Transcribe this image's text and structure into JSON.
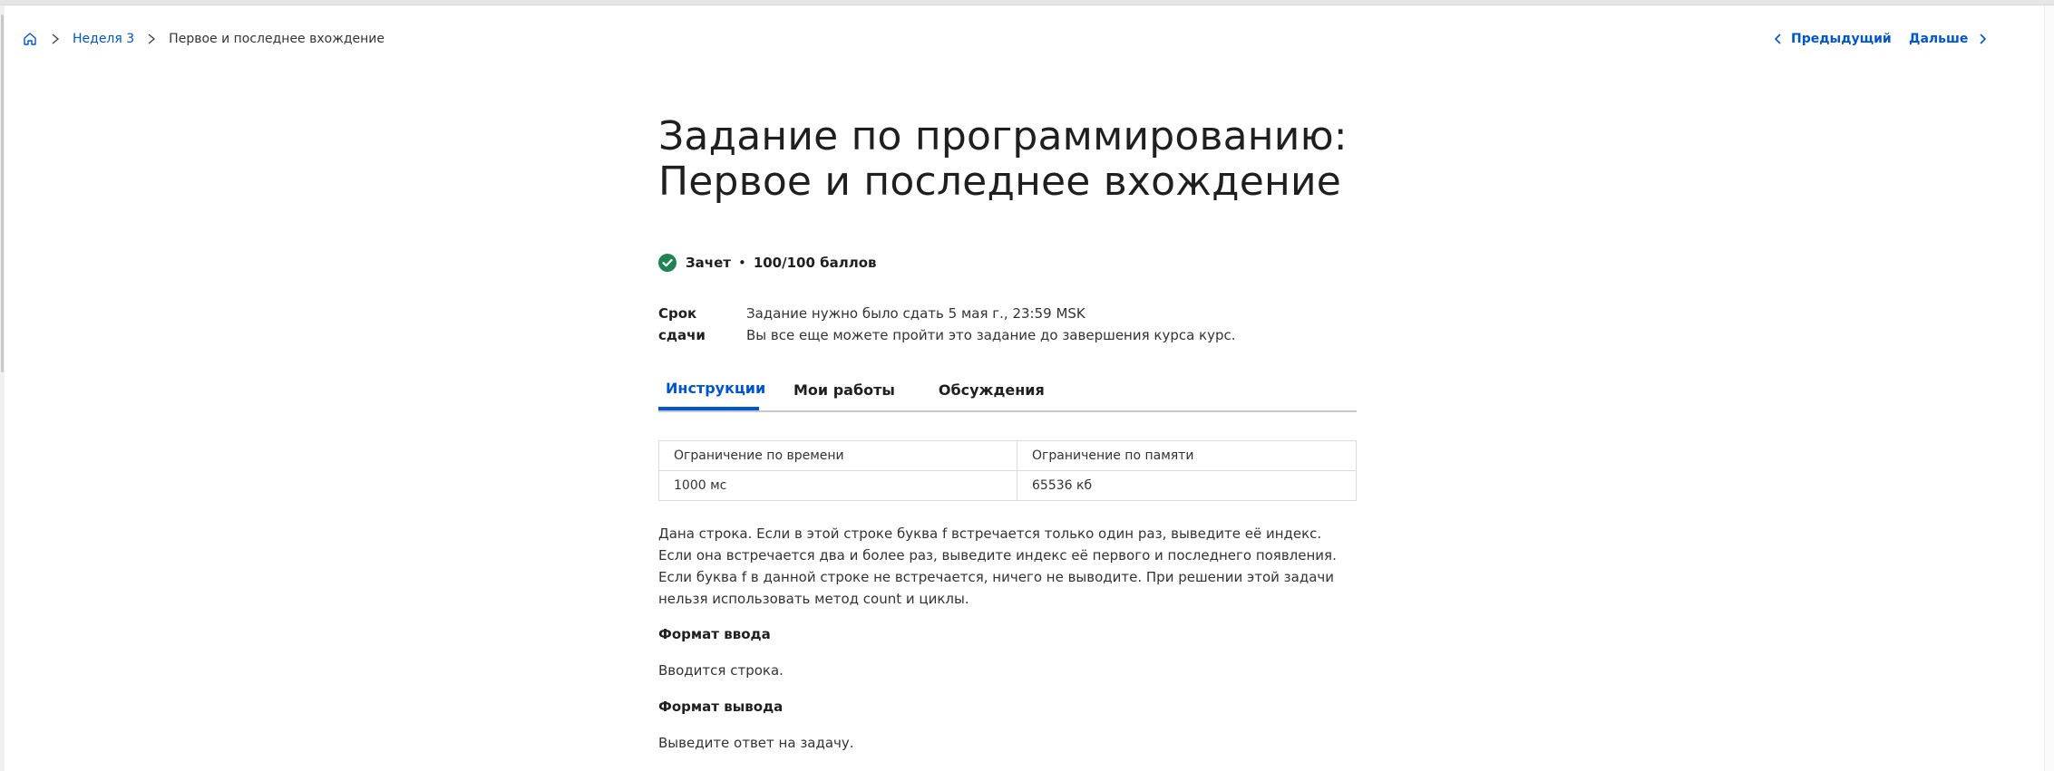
{
  "breadcrumb": {
    "home_icon": "home-icon",
    "week_link": "Неделя 3",
    "current": "Первое и последнее вхождение"
  },
  "nav": {
    "prev_label": "Предыдущий",
    "next_label": "Дальше"
  },
  "assignment": {
    "title_line1": "Задание по программированию:",
    "title_line2": "Первое и последнее вхождение",
    "status": {
      "label": "Зачет",
      "separator": "•",
      "score": "100/100 баллов"
    },
    "deadline": {
      "label": "Срок сдачи",
      "line1": "Задание нужно было сдать 5 мая г., 23:59 MSK",
      "line2": "Вы все еще можете пройти это задание до завершения курса курс."
    }
  },
  "tabs": [
    {
      "label": "Инструкции",
      "active": true
    },
    {
      "label": "Мои работы",
      "active": false
    },
    {
      "label": "Обсуждения",
      "active": false
    }
  ],
  "limits_table": {
    "headers": [
      "Ограничение по времени",
      "Ограничение по памяти"
    ],
    "values": [
      "1000 мс",
      "65536 кб"
    ]
  },
  "description": "Дана строка. Если в этой строке буква f встречается только один раз, выведите её индекс. Если она встречается два и более раз, выведите индекс её первого и последнего появления. Если буква f в данной строке не встречается, ничего не выводите. При решении этой задачи нельзя использовать метод count и циклы.",
  "input_format": {
    "heading": "Формат ввода",
    "text": "Вводится строка."
  },
  "output_format": {
    "heading": "Формат вывода",
    "text": "Выведите ответ на задачу."
  },
  "colors": {
    "accent": "#0056d2",
    "success": "#1f8354",
    "text": "#1f1f1f"
  }
}
